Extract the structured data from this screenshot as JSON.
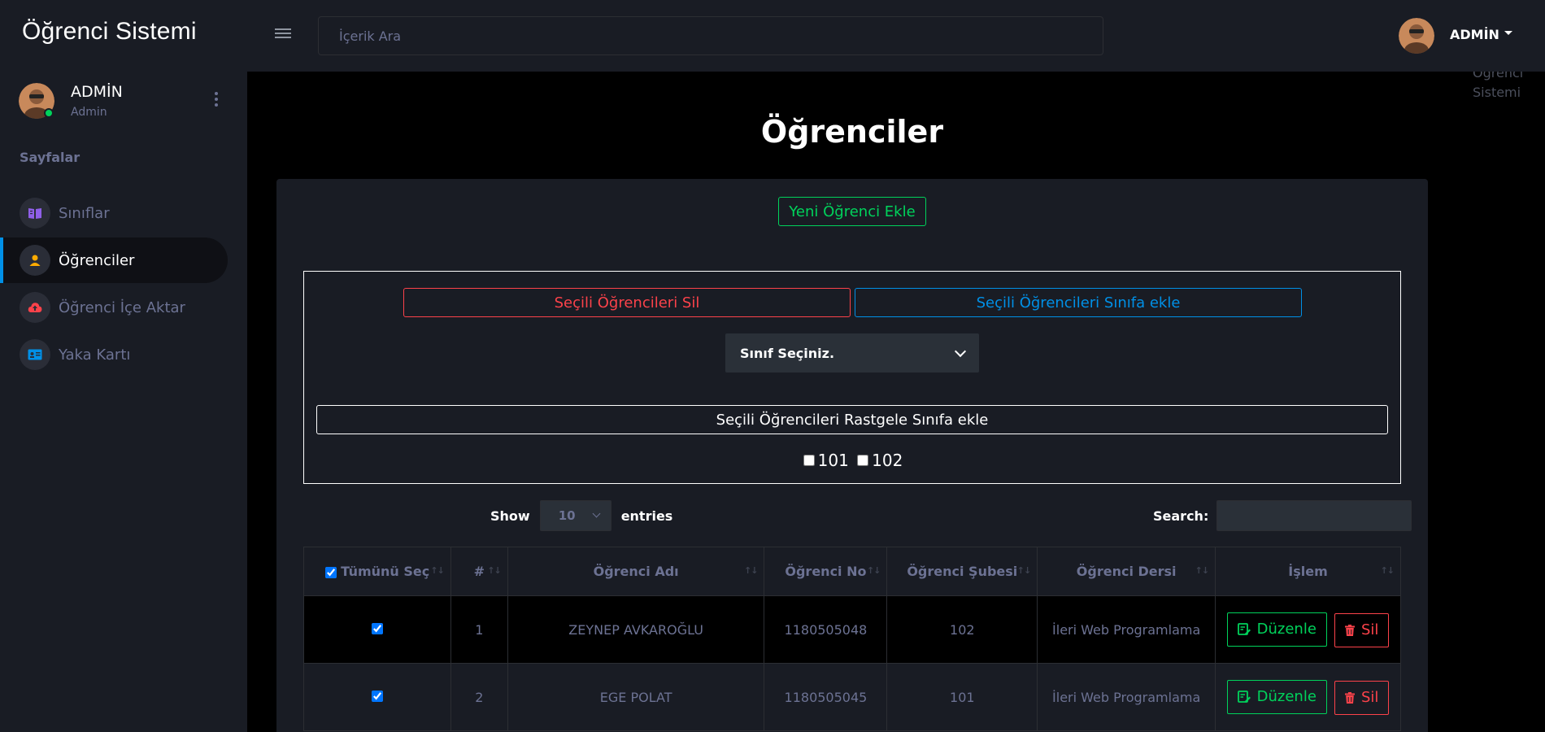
{
  "app": {
    "brand": "Öğrenci Sistemi",
    "search_placeholder": "İçerik Ara",
    "user_name": "ADMİN",
    "ghost_line1": "Öğrenci",
    "ghost_line2": "Sistemi"
  },
  "sidebar": {
    "profile_name": "ADMİN",
    "profile_role": "Admin",
    "section_title": "Sayfalar",
    "items": [
      {
        "label": "Sınıflar",
        "icon": "book-open-icon",
        "color": "#8f5fe8"
      },
      {
        "label": "Öğrenciler",
        "icon": "user-icon",
        "color": "#ffab00"
      },
      {
        "label": "Öğrenci İçe Aktar",
        "icon": "cloud-upload-icon",
        "color": "#fc424a"
      },
      {
        "label": "Yaka Kartı",
        "icon": "id-card-icon",
        "color": "#0090e7"
      }
    ]
  },
  "page": {
    "title": "Öğrenciler",
    "add_button": "Yeni Öğrenci Ekle",
    "delete_selected": "Seçili Öğrencileri Sil",
    "add_selected_class": "Seçili Öğrencileri Sınıfa ekle",
    "class_select": "Sınıf Seçiniz.",
    "random_assign": "Seçili Öğrencileri Rastgele Sınıfa ekle",
    "class_options": [
      "101",
      "102"
    ]
  },
  "table_controls": {
    "show": "Show",
    "length": "10",
    "entries": "entries",
    "search_label": "Search:"
  },
  "table": {
    "headers": [
      "Tümünü Seç",
      "#",
      "Öğrenci Adı",
      "Öğrenci No",
      "Öğrenci Şubesi",
      "Öğrenci Dersi",
      "İşlem"
    ],
    "edit_label": "Düzenle",
    "delete_label": "Sil",
    "rows": [
      {
        "index": "1",
        "name": "ZEYNEP AVKAROĞLU",
        "number": "1180505048",
        "branch": "102",
        "course": "İleri Web Programlama"
      },
      {
        "index": "2",
        "name": "EGE POLAT",
        "number": "1180505045",
        "branch": "101",
        "course": "İleri Web Programlama"
      }
    ]
  },
  "colors": {
    "success": "#00d25b",
    "danger": "#fc424a",
    "primary": "#0090e7",
    "sidebar_bg": "#191c24"
  }
}
